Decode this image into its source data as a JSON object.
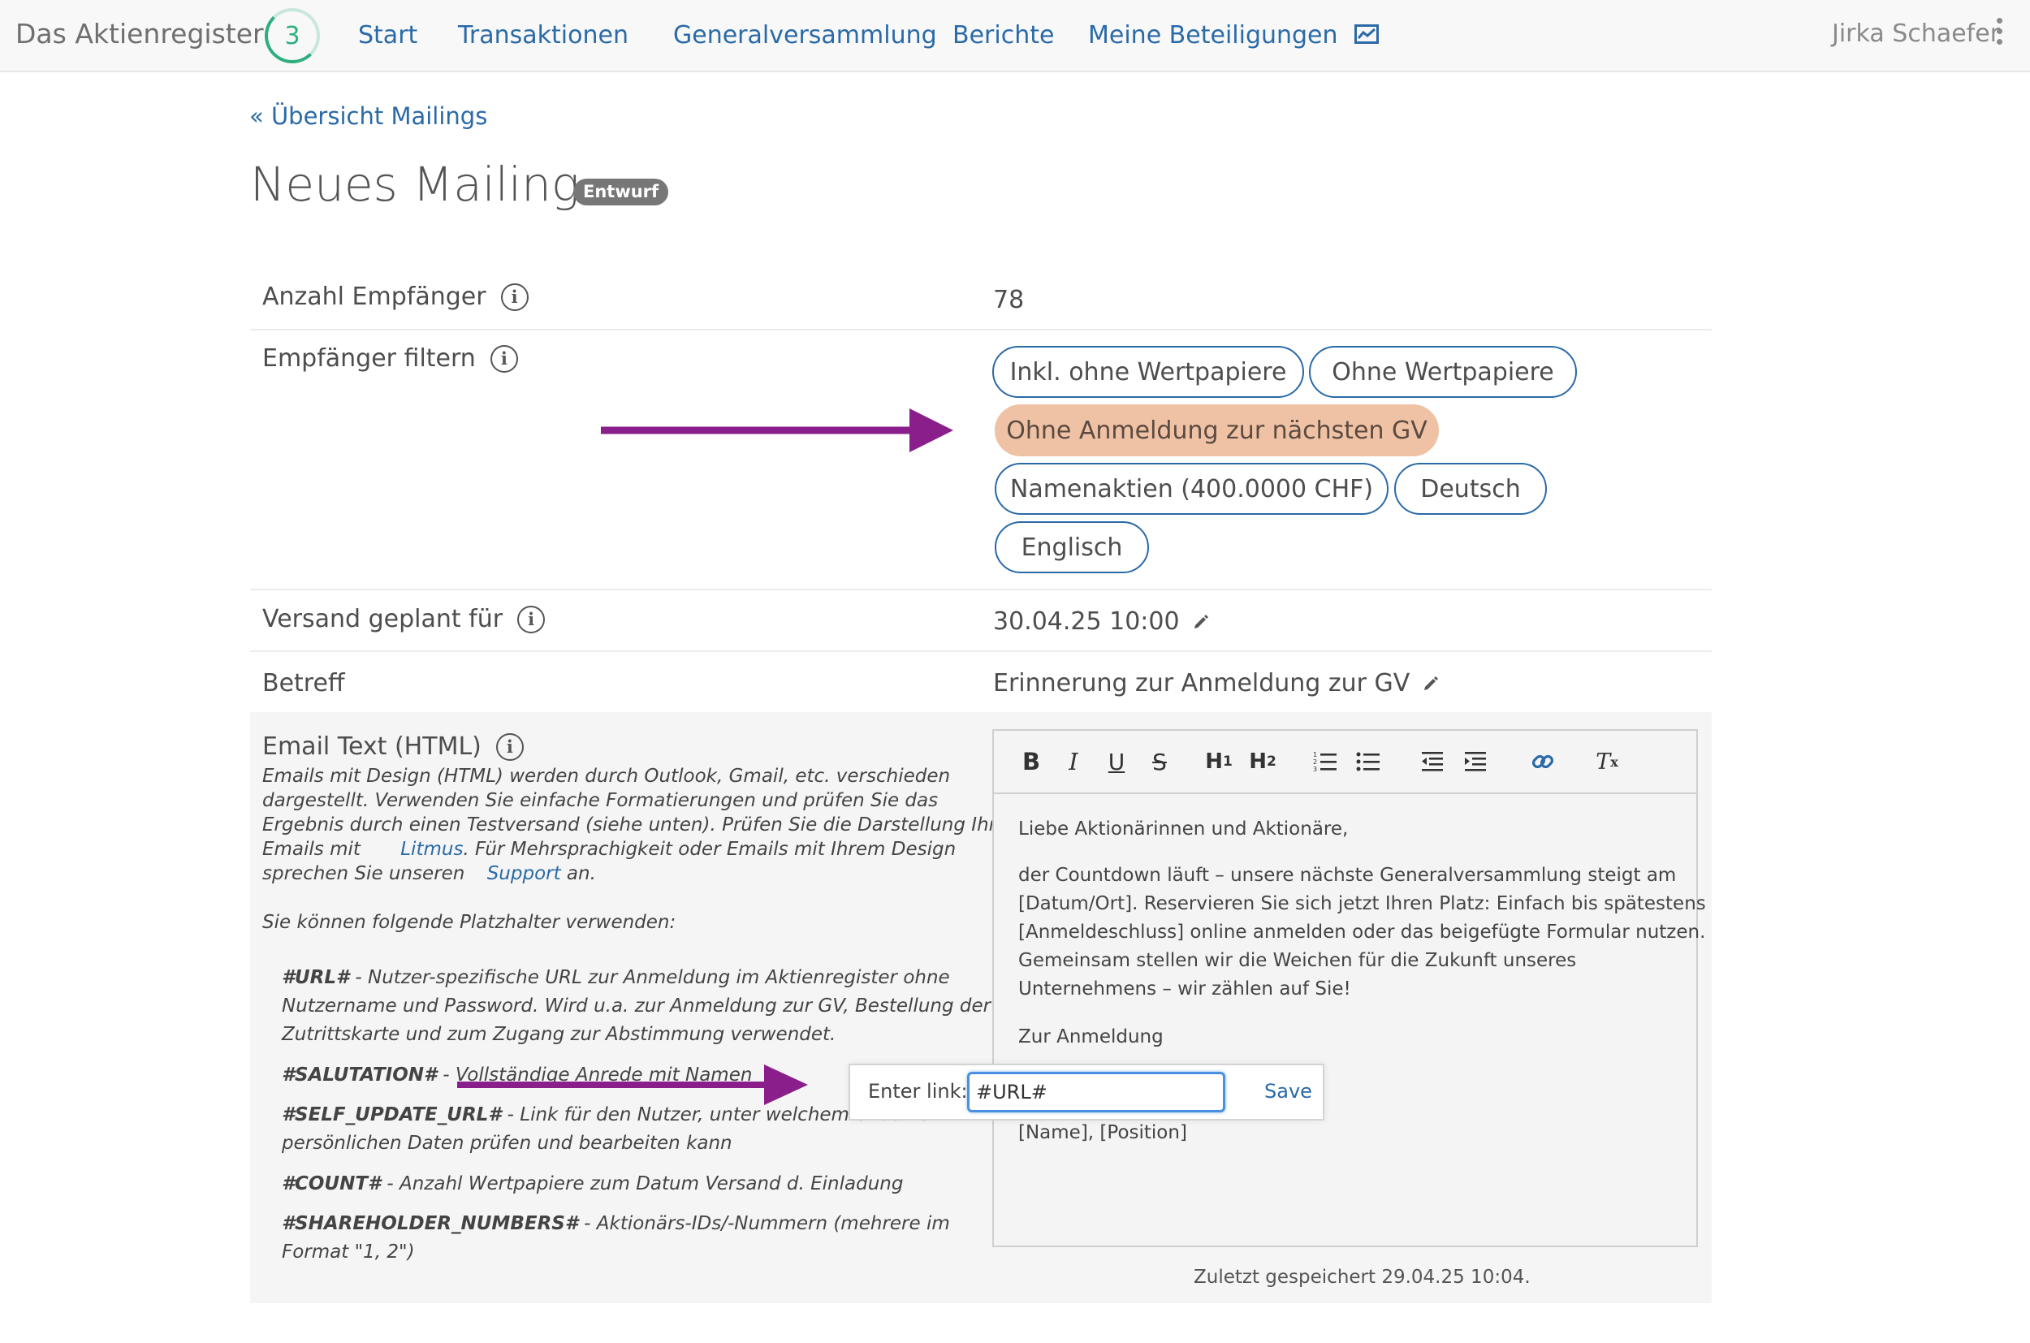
{
  "nav": {
    "brand": "Das Aktienregister",
    "badge_count": "3",
    "items": [
      "Start",
      "Transaktionen",
      "Generalversammlung",
      "Berichte",
      "Meine Beteiligungen"
    ],
    "chart_icon": "chart-icon",
    "user": "Jirka Schaefer"
  },
  "header": {
    "back_link": "« Übersicht Mailings",
    "title": "Neues Mailing",
    "status": "Entwurf"
  },
  "fields": {
    "recipients_label": "Anzahl Empfänger",
    "recipients_value": "78",
    "filter_label": "Empfänger filtern",
    "filters": [
      {
        "label": "Inkl. ohne Wertpapiere",
        "active": false
      },
      {
        "label": "Ohne Wertpapiere",
        "active": false
      },
      {
        "label": "Ohne Anmeldung zur nächsten GV",
        "active": true
      },
      {
        "label": "Namenaktien (400.0000 CHF)",
        "active": false
      },
      {
        "label": "Deutsch",
        "active": false
      },
      {
        "label": "Englisch",
        "active": false
      }
    ],
    "schedule_label": "Versand geplant für",
    "schedule_value": "30.04.25 10:00",
    "subject_label": "Betreff",
    "subject_value": "Erinnerung zur Anmeldung zur GV"
  },
  "email": {
    "label": "Email Text (HTML)",
    "hint_lines": [
      "Emails mit Design (HTML) werden durch Outlook, Gmail, etc. verschieden",
      "dargestellt. Verwenden Sie einfache Formatierungen und prüfen Sie das",
      "Ergebnis durch einen Testversand (siehe unten). Prüfen Sie die Darstellung Ihrer"
    ],
    "hint_line4_before": "Emails mit",
    "hint_litmus": "Litmus",
    "hint_line4_after": ". Für Mehrsprachigkeit oder Emails mit Ihrem Design",
    "hint_line5_before": "sprechen Sie unseren",
    "hint_support": "Support",
    "hint_line5_after": " an.",
    "placeholders_intro": "Sie können folgende Platzhalter verwenden:",
    "placeholders": [
      {
        "key": "#URL#",
        "lines": [
          " - Nutzer-spezifische URL zur Anmeldung im Aktienregister ohne",
          "Nutzername und Password. Wird u.a. zur Anmeldung zur GV, Bestellung der",
          "Zutrittskarte und zum Zugang zur Abstimmung verwendet."
        ]
      },
      {
        "key": "#SALUTATION#",
        "lines": [
          " - Vollständige Anrede mit Namen"
        ]
      },
      {
        "key": "#SELF_UPDATE_URL#",
        "lines": [
          " - Link für den Nutzer, unter welchem er seine",
          "persönlichen Daten prüfen und bearbeiten kann"
        ]
      },
      {
        "key": "#COUNT#",
        "lines": [
          " - Anzahl Wertpapiere zum Datum Versand d. Einladung"
        ]
      },
      {
        "key": "#SHAREHOLDER_NUMBERS#",
        "lines": [
          " - Aktionärs-IDs/-Nummern (mehrere im",
          "Format \"1, 2\")"
        ]
      }
    ],
    "toolbar": [
      "bold-icon",
      "italic-icon",
      "underline-icon",
      "strikethrough-icon",
      "heading1-icon",
      "heading2-icon",
      "ordered-list-icon",
      "bullet-list-icon",
      "outdent-icon",
      "indent-icon",
      "link-icon",
      "clear-format-icon"
    ],
    "body": {
      "greeting": "Liebe Aktionärinnen und Aktionäre,",
      "paragraph": [
        "der Countdown läuft – unsere nächste Generalversammlung steigt am",
        "[Datum/Ort]. Reservieren Sie sich jetzt Ihren Platz: Einfach bis spätestens",
        "[Anmeldeschluss] online anmelden oder das beigefügte Formular nutzen.",
        "Gemeinsam stellen wir die Weichen für die Zukunft unseres",
        "Unternehmens – wir zählen auf Sie!"
      ],
      "cta": "Zur Anmeldung",
      "signature": "[Name], [Position]"
    },
    "link_popup": {
      "label": "Enter link:",
      "value": "#URL#",
      "save": "Save"
    },
    "last_saved": "Zuletzt gespeichert 29.04.25 10:04."
  },
  "colors": {
    "link": "#2a6aa7",
    "active_chip": "#efc2a5",
    "arrow": "#8a1f8c",
    "badge_ring": "#2fae7d"
  }
}
